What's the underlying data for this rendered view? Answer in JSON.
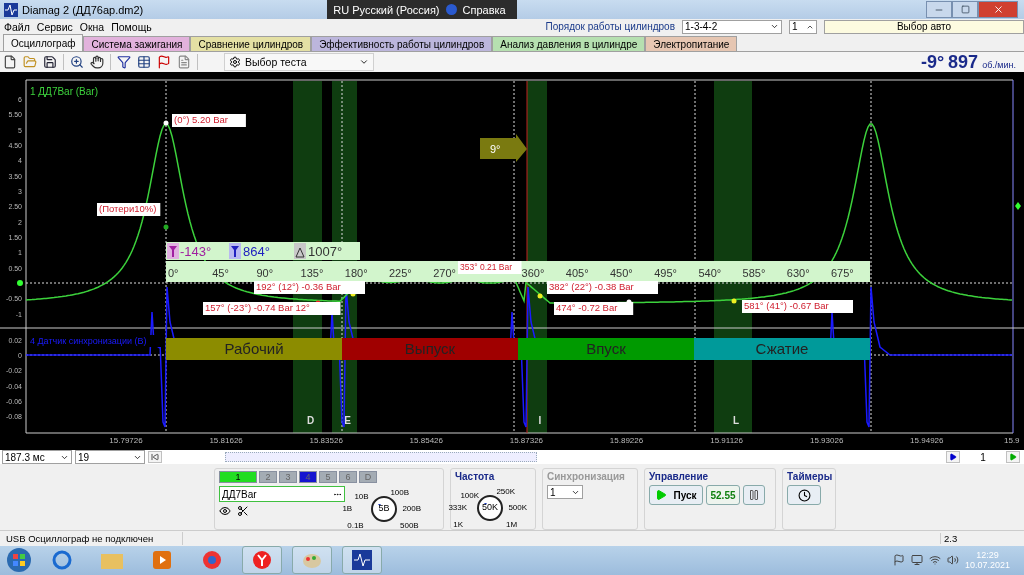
{
  "window": {
    "title": "Diamag 2 (ДД76ар.dm2)"
  },
  "language_bar": {
    "language": "RU Русский (Россия)",
    "help": "Справка"
  },
  "menu": [
    "Файл",
    "Сервис",
    "Окна",
    "Помощь"
  ],
  "cylinder_order": {
    "label": "Порядок работы цилиндров",
    "value": "1-3-4-2",
    "cylinder": "1",
    "car": "Выбор авто"
  },
  "tabs": [
    {
      "label": "Осциллограф",
      "selected": true,
      "color": "#f4f4f4"
    },
    {
      "label": "Система зажигания",
      "selected": false,
      "color": "#e2b2dc"
    },
    {
      "label": "Сравнение цилиндров",
      "selected": false,
      "color": "#e4e0a4"
    },
    {
      "label": "Эффективность работы цилиндров",
      "selected": false,
      "color": "#bcb6dc"
    },
    {
      "label": "Анализ давления в цилиндре",
      "selected": false,
      "color": "#b6e0b0"
    },
    {
      "label": "Электропитание",
      "selected": false,
      "color": "#e6c6b2"
    }
  ],
  "toolbar": {
    "test_select": "Выбор теста",
    "angle": "-9°",
    "rpm": "897",
    "rpm_unit": "об./мин."
  },
  "scope": {
    "channels": [
      {
        "label": "1 ДД7Bar (Bar)",
        "color": "#3cd23c",
        "y_ticks": [
          "6",
          "5.50",
          "5",
          "4.50",
          "4",
          "3.50",
          "3",
          "2.50",
          "2",
          "1.50",
          "1",
          "0.50",
          "-0.50",
          "-1"
        ]
      },
      {
        "label": "4 Датчик синхронизации (В)",
        "color": "#1a1aff",
        "y_ticks": [
          "0.02",
          "0",
          "-0.02",
          "-0.04",
          "-0.06",
          "-0.08"
        ]
      }
    ],
    "x_ticks": [
      "15.79726",
      "15.81626",
      "15.83526",
      "15.85426",
      "15.87326",
      "15.89226",
      "15.91126",
      "15.93026",
      "15.94926",
      "15.9"
    ],
    "zones": [
      "D",
      "E",
      "I",
      "L"
    ],
    "advance": "9°",
    "cursors": {
      "start": "-143°",
      "end": "864°",
      "delta": "1007°"
    },
    "degrees": [
      "0°",
      "45°",
      "90°",
      "135°",
      "180°",
      "225°",
      "270°",
      "360°",
      "405°",
      "450°",
      "495°",
      "540°",
      "585°",
      "630°",
      "675°"
    ],
    "phases": [
      {
        "label": "Рабочий",
        "color": "#8c8c00"
      },
      {
        "label": "Выпуск",
        "color": "#a00000"
      },
      {
        "label": "Впуск",
        "color": "#009a00"
      },
      {
        "label": "Сжатие",
        "color": "#009a9a"
      }
    ],
    "annotations": [
      "(0°) 5.20 Bar",
      "(Потери10%)",
      "192° (12°) -0.36 Bar",
      "157° (-23°) -0.74 Bar 12°",
      "353° 0.21 Bar",
      "382° (22°) -0.38 Bar",
      "474° -0.72 Bar",
      "581° (41°) -0.67 Bar"
    ]
  },
  "navigation": {
    "timebase": "187.3 мс",
    "count": "19",
    "frame": "1"
  },
  "channel_buttons": [
    {
      "label": "1",
      "selected": true,
      "color": "#22dd22"
    },
    {
      "label": "2",
      "selected": false,
      "color": "#a4acb4"
    },
    {
      "label": "3",
      "selected": false,
      "color": "#a4acb4"
    },
    {
      "label": "4",
      "selected": false,
      "color": "#1414d0"
    },
    {
      "label": "5",
      "selected": false,
      "color": "#a4acb4"
    },
    {
      "label": "6",
      "selected": false,
      "color": "#a4acb4"
    },
    {
      "label": "D",
      "selected": false,
      "color": "#a4acb4"
    }
  ],
  "channel_name": "ДД7Bar",
  "voltage_knob": {
    "labels": [
      "10В",
      "100В",
      "1В",
      "200В",
      "0.1В",
      "500В"
    ],
    "value": "5В"
  },
  "frequency": {
    "title": "Частота",
    "labels": [
      "100K",
      "250K",
      "333K",
      "500K",
      "1K",
      "1M"
    ],
    "value": "50K"
  },
  "sync": {
    "title": "Синхронизация",
    "channel": "1"
  },
  "control": {
    "title": "Управление",
    "start": "Пуск",
    "reading": "52.55"
  },
  "timers": {
    "title": "Таймеры"
  },
  "status_bar": {
    "message": "USB Осциллограф не подключен",
    "version": "2.3"
  },
  "taskbar": {
    "time": "12:29",
    "date": "10.07.2021"
  }
}
